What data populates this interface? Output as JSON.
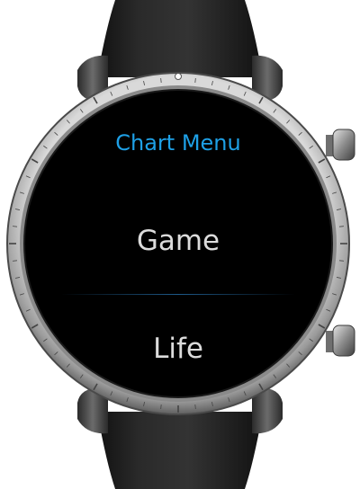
{
  "menu": {
    "title": "Chart Menu",
    "items": [
      {
        "label": "Game"
      },
      {
        "label": "Life"
      }
    ]
  },
  "colors": {
    "title": "#1ea0e6",
    "item_text": "#dcdcdc",
    "divider": "#1e5a8a",
    "screen_bg": "#000000"
  }
}
